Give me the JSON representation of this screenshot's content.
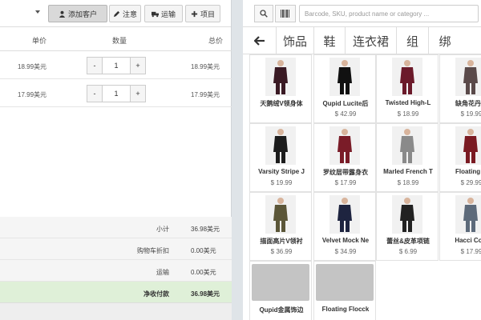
{
  "toolbar": {
    "add_customer": "添加客户",
    "note": "注意",
    "shipping": "运输",
    "item": "项目"
  },
  "cart": {
    "headers": {
      "price": "单价",
      "quantity": "数量",
      "total": "总价"
    },
    "rows": [
      {
        "price": "18.99美元",
        "qty": "1",
        "total": "18.99美元",
        "minus": "-",
        "plus": "+"
      },
      {
        "price": "17.99美元",
        "qty": "1",
        "total": "17.99美元",
        "minus": "-",
        "plus": "+"
      }
    ],
    "summary": {
      "subtotal_label": "小计",
      "subtotal": "36.98美元",
      "discount_label": "购物车折扣",
      "discount": "0.00美元",
      "shipping_label": "运输",
      "shipping": "0.00美元",
      "net_label": "净收付款",
      "net": "36.98美元"
    }
  },
  "search": {
    "placeholder": "Barcode, SKU, product name or category ..."
  },
  "categories": [
    "饰品",
    "鞋",
    "连衣裙",
    "组",
    "绑"
  ],
  "products": [
    {
      "name": "天鹅绒V领身体",
      "price": "",
      "color": "#3a1a24"
    },
    {
      "name": "Qupid Lucite后",
      "price": "$ 42.99",
      "color": "#111111"
    },
    {
      "name": "Twisted High-L",
      "price": "$ 18.99",
      "color": "#6b1a2a"
    },
    {
      "name": "缺角花丹套",
      "price": "$ 19.99",
      "color": "#5a4a4a"
    },
    {
      "name": "Varsity Stripe J",
      "price": "$ 19.99",
      "color": "#1c1c1c"
    },
    {
      "name": "罗纹层带露身衣",
      "price": "$ 17.99",
      "color": "#7a1c28"
    },
    {
      "name": "Marled French T",
      "price": "$ 18.99",
      "color": "#8a8a8a"
    },
    {
      "name": "Floating M",
      "price": "$ 29.99",
      "color": "#7a1a22"
    },
    {
      "name": "描面高片V领衬",
      "price": "$ 36.99",
      "color": "#5b5638"
    },
    {
      "name": "Velvet Mock Ne",
      "price": "$ 34.99",
      "color": "#1e2440"
    },
    {
      "name": "蕾丝&皮革项链",
      "price": "$ 6.99",
      "color": "#222222"
    },
    {
      "name": "Hacci Cold",
      "price": "$ 17.99",
      "color": "#5d6a7a"
    },
    {
      "name": "Qupid金属饰边",
      "price": "",
      "color": ""
    },
    {
      "name": "Floating Flocck",
      "price": "",
      "color": ""
    }
  ]
}
